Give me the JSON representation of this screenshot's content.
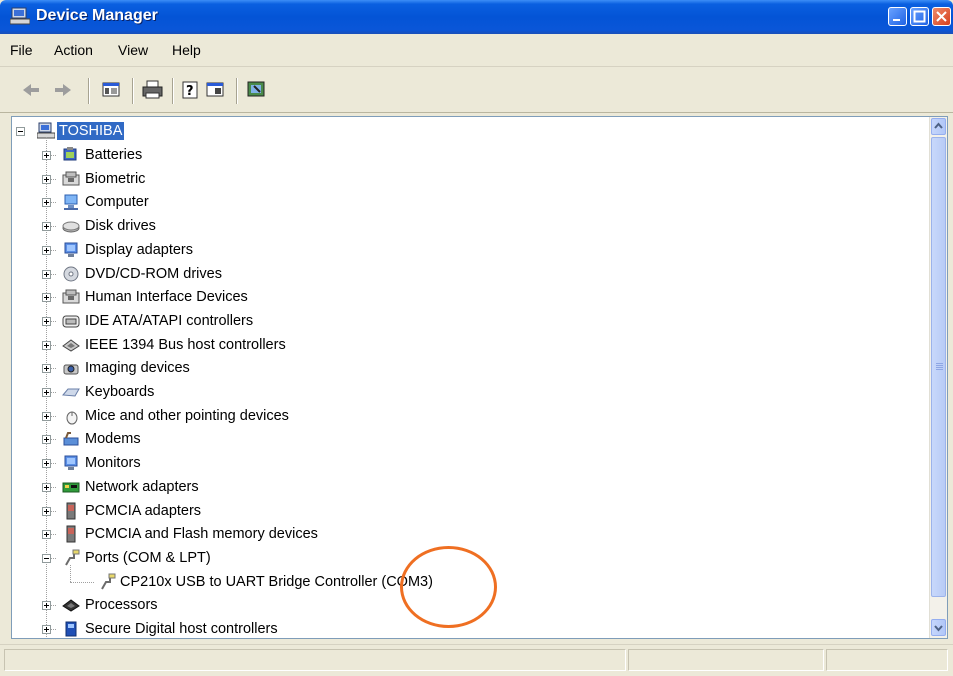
{
  "window": {
    "title": "Device Manager"
  },
  "menu": [
    "File",
    "Action",
    "View",
    "Help"
  ],
  "toolbar": {
    "buttons": [
      "back-arrow-icon",
      "forward-arrow-icon",
      "show-hide-tree-icon",
      "print-icon",
      "properties-help-icon",
      "view-icon",
      "scan-hardware-icon"
    ]
  },
  "tree": {
    "root": "TOSHIBA",
    "items": [
      {
        "label": "Batteries",
        "icon": "battery-icon"
      },
      {
        "label": "Biometric",
        "icon": "biometric-icon"
      },
      {
        "label": "Computer",
        "icon": "computer-icon"
      },
      {
        "label": "Disk drives",
        "icon": "disk-drive-icon"
      },
      {
        "label": "Display adapters",
        "icon": "display-adapter-icon"
      },
      {
        "label": "DVD/CD-ROM drives",
        "icon": "dvd-icon"
      },
      {
        "label": "Human Interface Devices",
        "icon": "hid-icon"
      },
      {
        "label": "IDE ATA/ATAPI controllers",
        "icon": "ide-controller-icon"
      },
      {
        "label": "IEEE 1394 Bus host controllers",
        "icon": "ieee1394-icon"
      },
      {
        "label": "Imaging devices",
        "icon": "camera-icon"
      },
      {
        "label": "Keyboards",
        "icon": "keyboard-icon"
      },
      {
        "label": "Mice and other pointing devices",
        "icon": "mouse-icon"
      },
      {
        "label": "Modems",
        "icon": "modem-icon"
      },
      {
        "label": "Monitors",
        "icon": "monitor-icon"
      },
      {
        "label": "Network adapters",
        "icon": "network-card-icon"
      },
      {
        "label": "PCMCIA adapters",
        "icon": "pcmcia-icon"
      },
      {
        "label": "PCMCIA and Flash memory devices",
        "icon": "pcmcia-icon"
      },
      {
        "label": "Ports (COM & LPT)",
        "icon": "port-icon",
        "expanded": true
      },
      {
        "label": "CP210x USB to UART Bridge Controller (COM3)",
        "icon": "port-icon",
        "child": true
      },
      {
        "label": "Processors",
        "icon": "processor-icon"
      },
      {
        "label": "Secure Digital host controllers",
        "icon": "sd-controller-icon"
      }
    ]
  },
  "colors": {
    "selection": "#316ac5",
    "annotation": "#ef6f22",
    "titlebar": "#0454d6"
  }
}
